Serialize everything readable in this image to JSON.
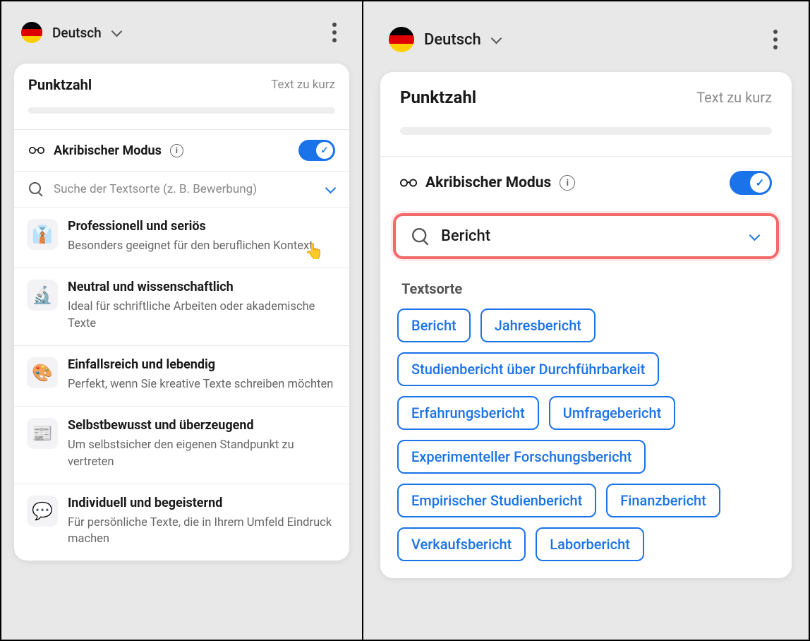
{
  "language": {
    "label": "Deutsch",
    "flag": "de"
  },
  "score": {
    "title": "Punktzahl",
    "status": "Text zu kurz"
  },
  "mode": {
    "label": "Akribischer Modus",
    "on": true
  },
  "left": {
    "search": {
      "placeholder": "Suche der Textsorte (z. B. Bewerbung)"
    },
    "styles": [
      {
        "icon": "👔",
        "title": "Professionell und seriös",
        "desc": "Besonders geeignet für den beruflichen Kontext",
        "hover": true
      },
      {
        "icon": "🔬",
        "title": "Neutral und wissenschaftlich",
        "desc": "Ideal für schriftliche Arbeiten oder akademische Texte"
      },
      {
        "icon": "🎨",
        "title": "Einfallsreich und lebendig",
        "desc": "Perfekt, wenn Sie kreative Texte schreiben möchten"
      },
      {
        "icon": "📰",
        "title": "Selbstbewusst und überzeugend",
        "desc": "Um selbstsicher den eigenen Standpunkt zu vertreten"
      },
      {
        "icon": "💬",
        "title": "Individuell und begeisternd",
        "desc": "Für persönliche Texte, die in Ihrem Umfeld Eindruck machen"
      }
    ]
  },
  "right": {
    "search": {
      "value": "Bericht"
    },
    "section_label": "Textsorte",
    "tags": [
      "Bericht",
      "Jahresbericht",
      "Studienbericht über Durchführbarkeit",
      "Erfahrungsbericht",
      "Umfragebericht",
      "Experimenteller Forschungsbericht",
      "Empirischer Studienbericht",
      "Finanzbericht",
      "Verkaufsbericht",
      "Laborbericht"
    ]
  }
}
